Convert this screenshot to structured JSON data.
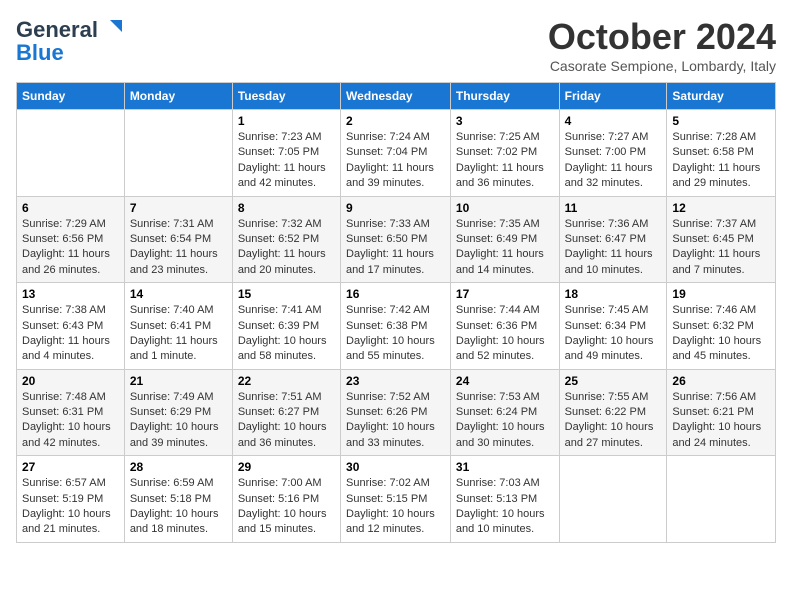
{
  "header": {
    "logo_line1": "General",
    "logo_line2": "Blue",
    "month": "October 2024",
    "location": "Casorate Sempione, Lombardy, Italy"
  },
  "weekdays": [
    "Sunday",
    "Monday",
    "Tuesday",
    "Wednesday",
    "Thursday",
    "Friday",
    "Saturday"
  ],
  "weeks": [
    [
      {
        "day": "",
        "info": ""
      },
      {
        "day": "",
        "info": ""
      },
      {
        "day": "1",
        "info": "Sunrise: 7:23 AM\nSunset: 7:05 PM\nDaylight: 11 hours and 42 minutes."
      },
      {
        "day": "2",
        "info": "Sunrise: 7:24 AM\nSunset: 7:04 PM\nDaylight: 11 hours and 39 minutes."
      },
      {
        "day": "3",
        "info": "Sunrise: 7:25 AM\nSunset: 7:02 PM\nDaylight: 11 hours and 36 minutes."
      },
      {
        "day": "4",
        "info": "Sunrise: 7:27 AM\nSunset: 7:00 PM\nDaylight: 11 hours and 32 minutes."
      },
      {
        "day": "5",
        "info": "Sunrise: 7:28 AM\nSunset: 6:58 PM\nDaylight: 11 hours and 29 minutes."
      }
    ],
    [
      {
        "day": "6",
        "info": "Sunrise: 7:29 AM\nSunset: 6:56 PM\nDaylight: 11 hours and 26 minutes."
      },
      {
        "day": "7",
        "info": "Sunrise: 7:31 AM\nSunset: 6:54 PM\nDaylight: 11 hours and 23 minutes."
      },
      {
        "day": "8",
        "info": "Sunrise: 7:32 AM\nSunset: 6:52 PM\nDaylight: 11 hours and 20 minutes."
      },
      {
        "day": "9",
        "info": "Sunrise: 7:33 AM\nSunset: 6:50 PM\nDaylight: 11 hours and 17 minutes."
      },
      {
        "day": "10",
        "info": "Sunrise: 7:35 AM\nSunset: 6:49 PM\nDaylight: 11 hours and 14 minutes."
      },
      {
        "day": "11",
        "info": "Sunrise: 7:36 AM\nSunset: 6:47 PM\nDaylight: 11 hours and 10 minutes."
      },
      {
        "day": "12",
        "info": "Sunrise: 7:37 AM\nSunset: 6:45 PM\nDaylight: 11 hours and 7 minutes."
      }
    ],
    [
      {
        "day": "13",
        "info": "Sunrise: 7:38 AM\nSunset: 6:43 PM\nDaylight: 11 hours and 4 minutes."
      },
      {
        "day": "14",
        "info": "Sunrise: 7:40 AM\nSunset: 6:41 PM\nDaylight: 11 hours and 1 minute."
      },
      {
        "day": "15",
        "info": "Sunrise: 7:41 AM\nSunset: 6:39 PM\nDaylight: 10 hours and 58 minutes."
      },
      {
        "day": "16",
        "info": "Sunrise: 7:42 AM\nSunset: 6:38 PM\nDaylight: 10 hours and 55 minutes."
      },
      {
        "day": "17",
        "info": "Sunrise: 7:44 AM\nSunset: 6:36 PM\nDaylight: 10 hours and 52 minutes."
      },
      {
        "day": "18",
        "info": "Sunrise: 7:45 AM\nSunset: 6:34 PM\nDaylight: 10 hours and 49 minutes."
      },
      {
        "day": "19",
        "info": "Sunrise: 7:46 AM\nSunset: 6:32 PM\nDaylight: 10 hours and 45 minutes."
      }
    ],
    [
      {
        "day": "20",
        "info": "Sunrise: 7:48 AM\nSunset: 6:31 PM\nDaylight: 10 hours and 42 minutes."
      },
      {
        "day": "21",
        "info": "Sunrise: 7:49 AM\nSunset: 6:29 PM\nDaylight: 10 hours and 39 minutes."
      },
      {
        "day": "22",
        "info": "Sunrise: 7:51 AM\nSunset: 6:27 PM\nDaylight: 10 hours and 36 minutes."
      },
      {
        "day": "23",
        "info": "Sunrise: 7:52 AM\nSunset: 6:26 PM\nDaylight: 10 hours and 33 minutes."
      },
      {
        "day": "24",
        "info": "Sunrise: 7:53 AM\nSunset: 6:24 PM\nDaylight: 10 hours and 30 minutes."
      },
      {
        "day": "25",
        "info": "Sunrise: 7:55 AM\nSunset: 6:22 PM\nDaylight: 10 hours and 27 minutes."
      },
      {
        "day": "26",
        "info": "Sunrise: 7:56 AM\nSunset: 6:21 PM\nDaylight: 10 hours and 24 minutes."
      }
    ],
    [
      {
        "day": "27",
        "info": "Sunrise: 6:57 AM\nSunset: 5:19 PM\nDaylight: 10 hours and 21 minutes."
      },
      {
        "day": "28",
        "info": "Sunrise: 6:59 AM\nSunset: 5:18 PM\nDaylight: 10 hours and 18 minutes."
      },
      {
        "day": "29",
        "info": "Sunrise: 7:00 AM\nSunset: 5:16 PM\nDaylight: 10 hours and 15 minutes."
      },
      {
        "day": "30",
        "info": "Sunrise: 7:02 AM\nSunset: 5:15 PM\nDaylight: 10 hours and 12 minutes."
      },
      {
        "day": "31",
        "info": "Sunrise: 7:03 AM\nSunset: 5:13 PM\nDaylight: 10 hours and 10 minutes."
      },
      {
        "day": "",
        "info": ""
      },
      {
        "day": "",
        "info": ""
      }
    ]
  ]
}
